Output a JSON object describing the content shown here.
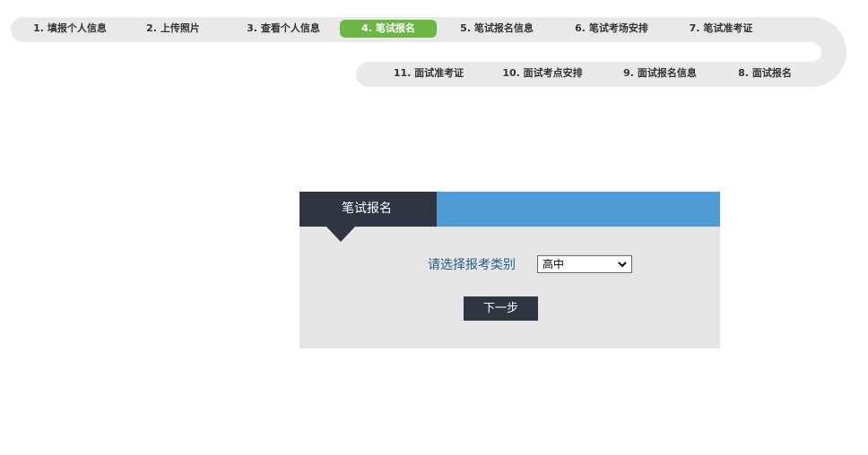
{
  "steps": {
    "top": [
      {
        "label": "1. 填报个人信息"
      },
      {
        "label": "2. 上传照片"
      },
      {
        "label": "3. 查看个人信息"
      },
      {
        "label": "4. 笔试报名"
      },
      {
        "label": "5. 笔试报名信息"
      },
      {
        "label": "6. 笔试考场安排"
      },
      {
        "label": "7. 笔试准考证"
      }
    ],
    "bottom": [
      {
        "label": "11. 面试准考证"
      },
      {
        "label": "10. 面试考点安排"
      },
      {
        "label": "9. 面试报名信息"
      },
      {
        "label": "8. 面试报名"
      }
    ],
    "active_step": 4,
    "track_color": "#e9e9e9",
    "active_color": "#6cb645"
  },
  "panel": {
    "title": "笔试报名",
    "field_label": "请选择报考类别",
    "select_value": "高中",
    "next_label": "下一步",
    "header_color": "#4e9bd6",
    "tab_color": "#2f3642"
  }
}
